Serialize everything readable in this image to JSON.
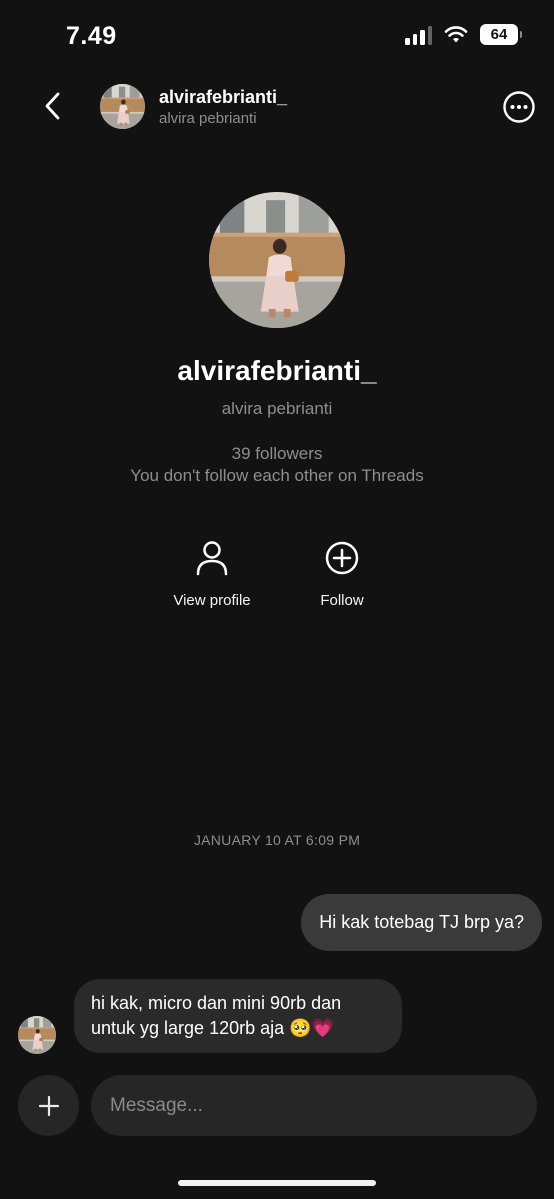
{
  "status_bar": {
    "time": "7.49",
    "battery": "64",
    "icons": [
      "signal-icon",
      "wifi-icon",
      "battery-icon"
    ]
  },
  "header": {
    "username": "alvirafebrianti_",
    "display_name": "alvira pebrianti",
    "icons": [
      "back-arrow-icon",
      "more-options-icon"
    ]
  },
  "profile": {
    "username": "alvirafebrianti_",
    "display_name": "alvira pebrianti",
    "followers": "39 followers",
    "follow_note": "You don't follow each other on Threads",
    "actions": [
      {
        "label": "View profile",
        "icon": "person-icon"
      },
      {
        "label": "Follow",
        "icon": "plus-circle-icon"
      }
    ]
  },
  "conversation": {
    "timestamp": "JANUARY 10 AT 6:09 PM",
    "messages": [
      {
        "direction": "outgoing",
        "text": "Hi kak totebag TJ brp ya?"
      },
      {
        "direction": "incoming",
        "text": "hi kak, micro dan mini 90rb dan untuk yg large 120rb aja 🥺💗"
      }
    ]
  },
  "composer": {
    "placeholder": "Message...",
    "value": "",
    "icon": "plus-icon"
  },
  "colors": {
    "background": "#121212",
    "outgoing_bubble": "#3a3a3a",
    "incoming_bubble": "#2a2a2a",
    "secondary_text": "#8e8e8e"
  }
}
